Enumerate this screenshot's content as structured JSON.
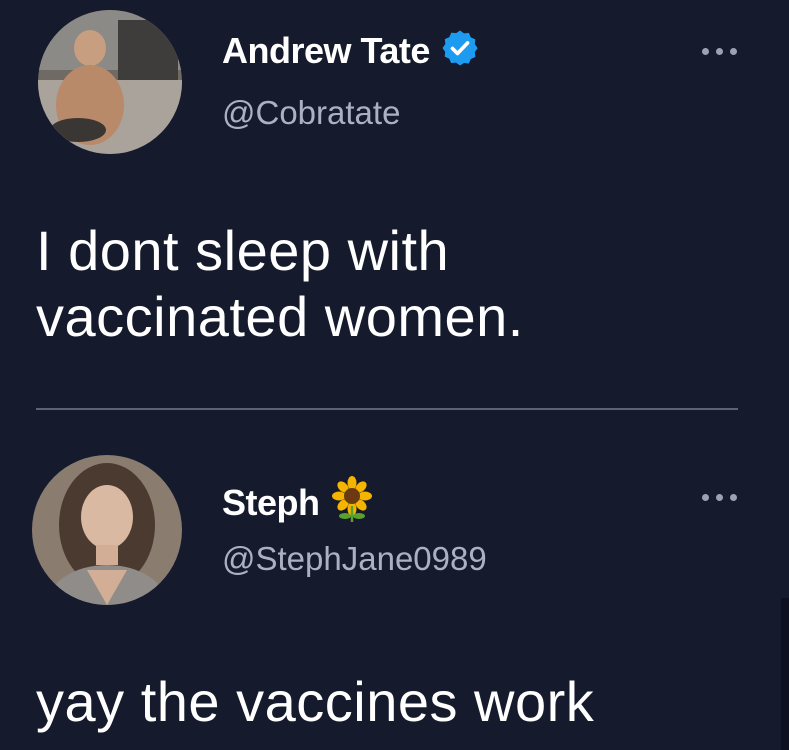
{
  "tweets": [
    {
      "display_name": "Andrew Tate",
      "handle": "@Cobratate",
      "badge": "verified-check-icon",
      "text": "I dont sleep with vaccinated women."
    },
    {
      "display_name": "Steph",
      "handle": "@StephJane0989",
      "badge": "sunflower-icon",
      "text": "yay the vaccines work"
    }
  ],
  "colors": {
    "background": "#151a2d",
    "text_primary": "#ffffff",
    "text_secondary": "#a9b1c3",
    "verified_blue": "#1d9bf0",
    "divider": "#5a6277"
  }
}
